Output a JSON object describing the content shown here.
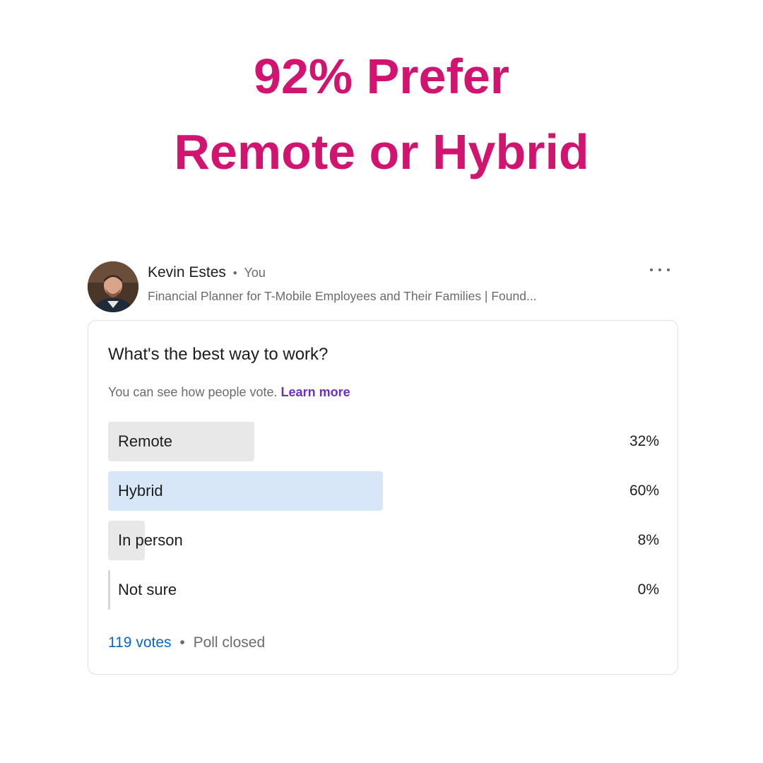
{
  "headline": {
    "line1": "92% Prefer",
    "line2": "Remote or Hybrid",
    "color": "#d0146f"
  },
  "author": {
    "name": "Kevin Estes",
    "separator": "•",
    "relation": "You",
    "headline": "Financial Planner for T-Mobile Employees and Their Families | Found..."
  },
  "poll": {
    "question": "What's the best way to work?",
    "visibility_text": "You can see how people vote.",
    "learn_more_label": "Learn more",
    "options": [
      {
        "label": "Remote",
        "percent_label": "32%",
        "percent": 32,
        "leader": false
      },
      {
        "label": "Hybrid",
        "percent_label": "60%",
        "percent": 60,
        "leader": true
      },
      {
        "label": "In person",
        "percent_label": "8%",
        "percent": 8,
        "leader": false
      },
      {
        "label": "Not sure",
        "percent_label": "0%",
        "percent": 0,
        "leader": false
      }
    ],
    "votes_label": "119 votes",
    "footer_separator": "•",
    "status": "Poll closed"
  },
  "colors": {
    "accent_link": "#0a66c2",
    "learn_more": "#6a2fc4",
    "leader_bar": "#d8e7f8",
    "bar": "#e8e8e8"
  }
}
